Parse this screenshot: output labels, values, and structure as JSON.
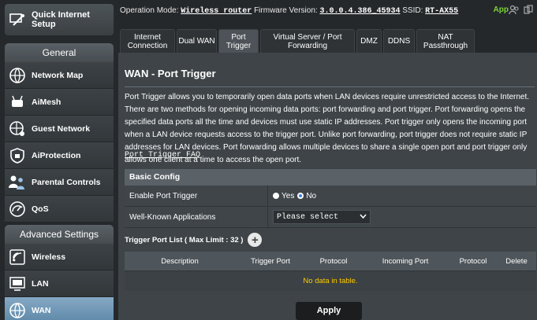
{
  "sidebar": {
    "quick_setup": "Quick Internet Setup",
    "general_title": "General",
    "general_items": [
      {
        "label": "Network Map",
        "icon": "network-map-icon"
      },
      {
        "label": "AiMesh",
        "icon": "aimesh-icon"
      },
      {
        "label": "Guest Network",
        "icon": "guest-network-icon"
      },
      {
        "label": "AiProtection",
        "icon": "aiprotection-icon"
      },
      {
        "label": "Parental Controls",
        "icon": "parental-controls-icon"
      },
      {
        "label": "QoS",
        "icon": "qos-icon"
      }
    ],
    "advanced_title": "Advanced Settings",
    "advanced_items": [
      {
        "label": "Wireless",
        "icon": "wireless-icon"
      },
      {
        "label": "LAN",
        "icon": "lan-icon"
      },
      {
        "label": "WAN",
        "icon": "wan-icon",
        "active": true
      }
    ]
  },
  "topbar": {
    "mode_label": "Operation Mode:",
    "mode_value": "Wireless router",
    "fw_label": "Firmware Version:",
    "fw_value": "3.0.0.4.386_45934",
    "ssid_label": "SSID:",
    "ssid_value": "RT-AX55",
    "app_label": "App"
  },
  "tabs": [
    {
      "label": "Internet Connection"
    },
    {
      "label": "Dual WAN"
    },
    {
      "label": "Port Trigger",
      "active": true
    },
    {
      "label": "Virtual Server / Port Forwarding"
    },
    {
      "label": "DMZ"
    },
    {
      "label": "DDNS"
    },
    {
      "label": "NAT Passthrough"
    }
  ],
  "main": {
    "title": "WAN - Port Trigger",
    "description": "Port Trigger allows you to temporarily open data ports when LAN devices require unrestricted access to the Internet. There are two methods for opening incoming data ports: port forwarding and port trigger. Port forwarding opens the specified data ports all the time and devices must use static IP addresses. Port trigger only opens the incoming port when a LAN device requests access to the trigger port. Unlike port forwarding, port trigger does not require static IP addresses for LAN devices. Port forwarding allows multiple devices to share a single open port and port trigger only allows one client at a time to access the open port.",
    "faq_link": "Port Trigger FAQ",
    "basic_config": "Basic Config",
    "enable_label": "Enable Port Trigger",
    "yes_label": "Yes",
    "no_label": "No",
    "enabled": false,
    "apps_label": "Well-Known Applications",
    "apps_select": "Please select",
    "list_title": "Trigger Port List ( Max Limit : 32 )",
    "columns": [
      "Description",
      "Trigger Port",
      "Protocol",
      "Incoming Port",
      "Protocol",
      "Delete"
    ],
    "empty_text": "No data in table.",
    "apply_label": "Apply"
  },
  "colors": {
    "accent_active": "#6f97b6",
    "app_green": "#7dd23a",
    "empty_text": "#ffcc00"
  }
}
